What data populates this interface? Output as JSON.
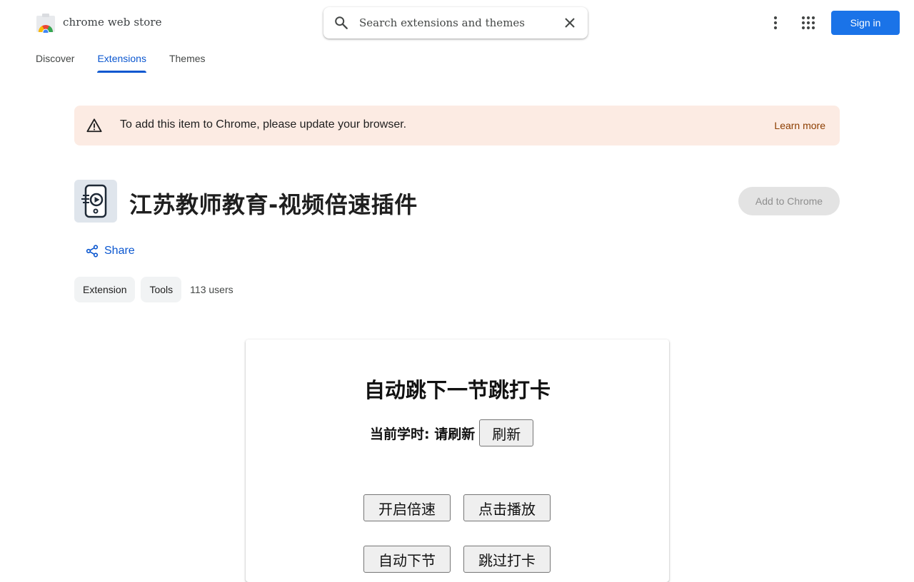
{
  "header": {
    "store_name": "chrome web store",
    "search_placeholder": "Search extensions and themes",
    "sign_in_label": "Sign in",
    "icons": [
      "chrome-web-store-logo",
      "search-icon",
      "close-icon",
      "more-vert-icon",
      "apps-grid-icon"
    ]
  },
  "nav": {
    "tabs": [
      {
        "label": "Discover",
        "active": false
      },
      {
        "label": "Extensions",
        "active": true
      },
      {
        "label": "Themes",
        "active": false
      }
    ]
  },
  "banner": {
    "message": "To add this item to Chrome, please update your browser.",
    "link_label": "Learn more",
    "icon": "warning-icon",
    "bg_color": "#fcebe3"
  },
  "extension": {
    "title": "江苏教师教育-视频倍速插件",
    "add_label": "Add to Chrome",
    "share_label": "Share",
    "chips": [
      "Extension",
      "Tools"
    ],
    "users": "113 users"
  },
  "screenshot": {
    "heading": "自动跳下一节跳打卡",
    "hours_label": "当前学时: 请刷新",
    "refresh_label": "刷新",
    "buttons": [
      "开启倍速",
      "点击播放",
      "自动下节",
      "跳过打卡"
    ]
  },
  "colors": {
    "accent": "#0b57d0",
    "sign_in_bg": "#1a73e8",
    "learn_more": "#8c3d00"
  }
}
